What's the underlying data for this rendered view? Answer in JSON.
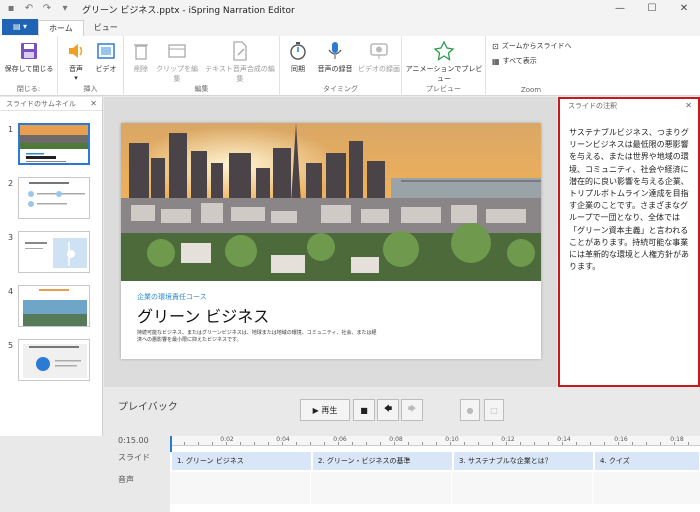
{
  "window": {
    "title": "グリーン ビジネス.pptx - iSpring Narration Editor",
    "undo": "↶",
    "redo": "↷",
    "minimize": "—",
    "maximize": "☐",
    "close": "✕"
  },
  "tabs": {
    "file": "▤ ▾",
    "home": "ホーム",
    "view": "ビュー"
  },
  "ribbon": {
    "save_close": "保存して閉じる",
    "close_group": "閉じる:",
    "audio": "音声",
    "video": "ビデオ",
    "insert_group": "挿入",
    "delete": "削除",
    "edit_clip": "クリップを編集",
    "tts_edit": "テキスト音声合成の編集",
    "edit_group": "編集",
    "sync": "同期",
    "record_audio": "音声の録音",
    "record_video": "ビデオの録画",
    "timing_group": "タイミング",
    "preview_anim": "アニメーションでプレビュー",
    "preview_group": "プレビュー",
    "zoom_fit": "ズームからスライドへ",
    "show_all": "すべて表示",
    "zoom_group": "Zoom"
  },
  "thumbnails": {
    "header": "スライドのサムネイル",
    "close": "✕",
    "items": [
      {
        "num": "1"
      },
      {
        "num": "2"
      },
      {
        "num": "3"
      },
      {
        "num": "4"
      },
      {
        "num": "5"
      }
    ]
  },
  "slide": {
    "subtitle": "企業の環境責任コース",
    "title": "グリーン ビジネス",
    "body": "持続可能なビジネス、またはグリーンビジネスは、地球または地域の環境、コミュニティ、社会、または経済への悪影響を最小限に抑えたビジネスです。"
  },
  "notes": {
    "header": "スライドの注釈",
    "close": "✕",
    "text": "サステナブルビジネス、つまりグリーンビジネスは最低限の悪影響を与える、または世界や地域の環境、コミュニティ、社会や経済に潜在的に良い影響を与える企業、トリプルボトムライン達成を目指す企業のことです。さまざまなグループで一団となり、全体では「グリーン資本主義」と言われることがあります。持続可能な事業には革新的な環境と人権方針があります。"
  },
  "playback": {
    "title": "プレイバック",
    "play": "▶ 再生",
    "stop": "■",
    "prev": "🡄",
    "next": "🡆"
  },
  "timeline": {
    "current_time": "0:15.00",
    "slide_row": "スライド",
    "audio_row": "音声",
    "ticks": [
      "0:02",
      "0:04",
      "0:06",
      "0:08",
      "0:10",
      "0:12",
      "0:14",
      "0:16",
      "0:18"
    ],
    "segments": [
      "1. グリーン ビジネス",
      "2. グリーン・ビジネスの基準",
      "3. サステナブルな企業とは？",
      "4. クイズ"
    ]
  },
  "colors": {
    "accent": "#1f64b4",
    "notes_border": "#c8191c",
    "segment": "#d9e6f7"
  }
}
